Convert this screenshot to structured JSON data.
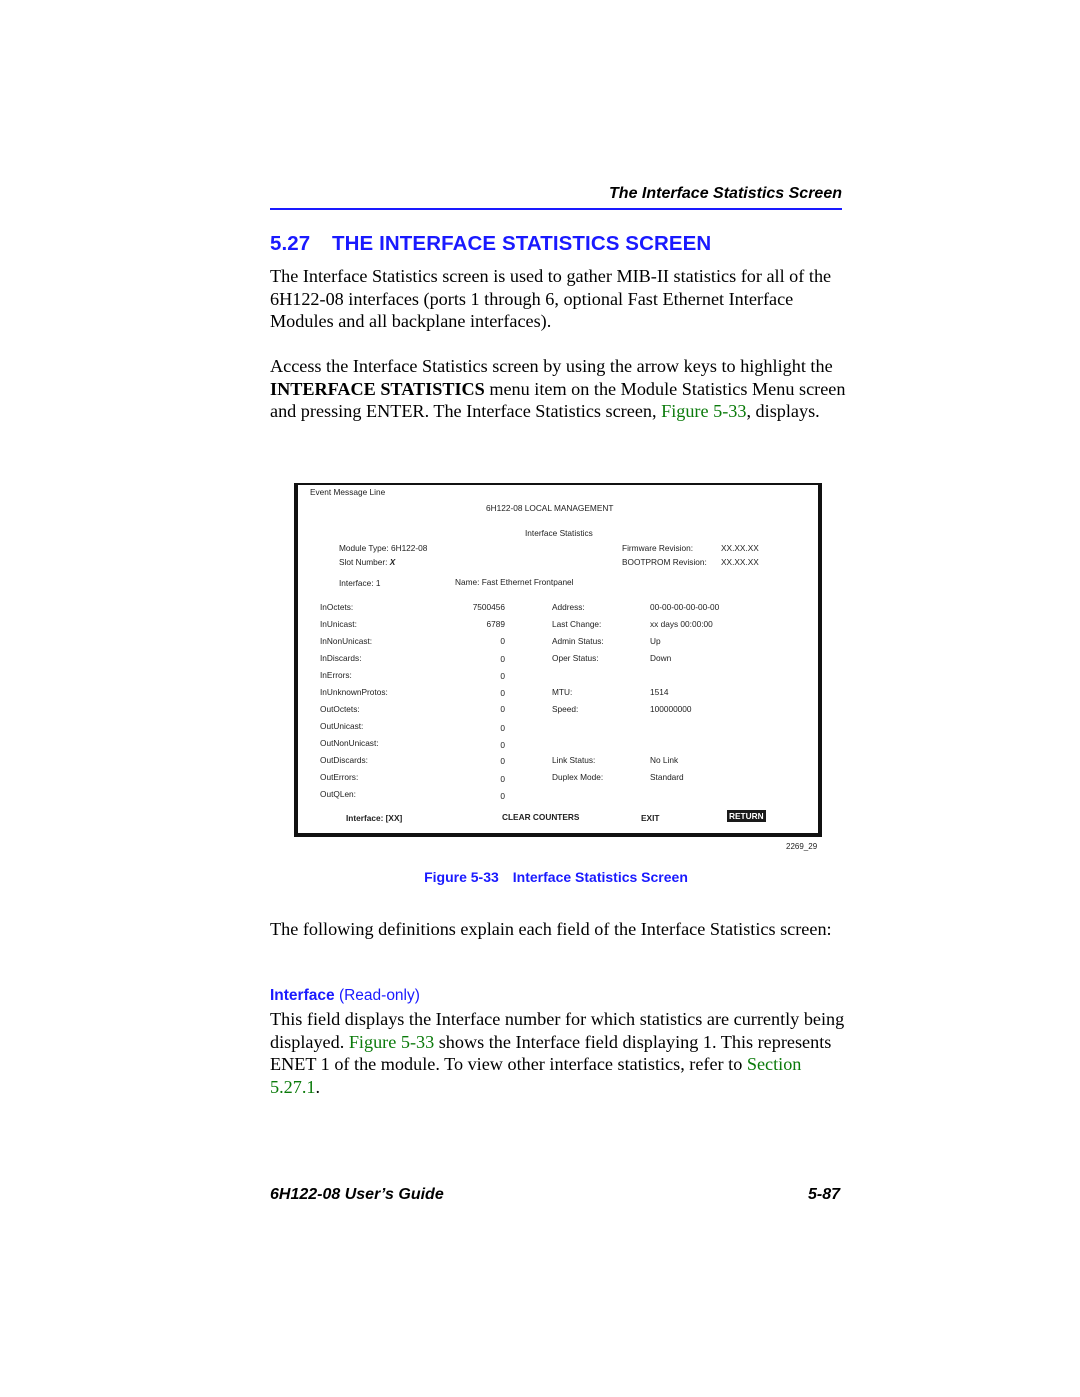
{
  "page": {
    "running_head": "The Interface Statistics Screen",
    "section_number": "5.27",
    "section_title": "THE INTERFACE STATISTICS SCREEN",
    "paragraph1": "The Interface Statistics screen is used to gather MIB-II statistics for all of the 6H122-08 interfaces (ports 1 through 6, optional Fast Ethernet Interface Modules and all backplane interfaces).",
    "paragraph2": {
      "before_bold": "Access the Interface Statistics screen by using the arrow keys to highlight the ",
      "bold": "INTERFACE STATISTICS",
      "after_bold": " menu item on the Module Statistics Menu screen and pressing ENTER. The Interface Statistics screen, ",
      "link": "Figure 5-33",
      "end": ", displays."
    },
    "figure_caption_label": "Figure 5-33",
    "figure_caption_title": "Interface Statistics Screen",
    "figure_id": "2269_29",
    "paragraph3": "The following definitions explain each field of the Interface Statistics screen:",
    "field_name": "Interface",
    "field_mode": "(Read-only)",
    "paragraph4": {
      "start": "This field displays the Interface number for which statistics are currently being displayed. ",
      "link1": "Figure 5-33",
      "middle": " shows the Interface field displaying 1. This represents ENET 1 of the module. To view other interface statistics, refer to ",
      "link2": "Section 5.27.1",
      "end": "."
    },
    "footer_left": "6H122-08 User’s Guide",
    "footer_right": "5-87"
  },
  "terminal": {
    "event_line": "Event Message Line",
    "title": "6H122-08 LOCAL MANAGEMENT",
    "subtitle": "Interface  Statistics",
    "module_type_label": "Module Type: 6H122-08",
    "slot_label": "Slot Number: ",
    "slot_value": "X",
    "firmware_label": "Firmware Revision:",
    "firmware_value": "XX.XX.XX",
    "bootprom_label": "BOOTPROM Revision:",
    "bootprom_value": "XX.XX.XX",
    "interface_label": "Interface:  1",
    "name_label": "Name:  Fast Ethernet Frontpanel",
    "counters": [
      {
        "label": "InOctets:",
        "value": "7500456"
      },
      {
        "label": "InUnicast:",
        "value": "6789"
      },
      {
        "label": "InNonUnicast:",
        "value": "0"
      },
      {
        "label": "InDiscards:",
        "value": "0"
      },
      {
        "label": "InErrors:",
        "value": "0"
      },
      {
        "label": "InUnknownProtos:",
        "value": "0"
      },
      {
        "label": "OutOctets:",
        "value": "0"
      },
      {
        "label": "OutUnicast:",
        "value": "0"
      },
      {
        "label": "OutNonUnicast:",
        "value": "0"
      },
      {
        "label": "OutDiscards:",
        "value": "0"
      },
      {
        "label": "OutErrors:",
        "value": "0"
      },
      {
        "label": "OutQLen:",
        "value": "0"
      }
    ],
    "info": [
      {
        "label": "Address:",
        "value": "00-00-00-00-00-00"
      },
      {
        "label": "Last Change:",
        "value": "xx days 00:00:00"
      },
      {
        "label": "Admin Status:",
        "value": "Up"
      },
      {
        "label": "Oper Status:",
        "value": "Down"
      },
      {
        "label": "MTU:",
        "value": "1514"
      },
      {
        "label": "Speed:",
        "value": "100000000"
      },
      {
        "label": "Link Status:",
        "value": "No Link"
      },
      {
        "label": "Duplex Mode:",
        "value": "Standard"
      }
    ],
    "commands": {
      "interface": "Interface:  [XX]",
      "clear": "CLEAR COUNTERS",
      "exit": "EXIT",
      "return": "RETURN"
    }
  }
}
